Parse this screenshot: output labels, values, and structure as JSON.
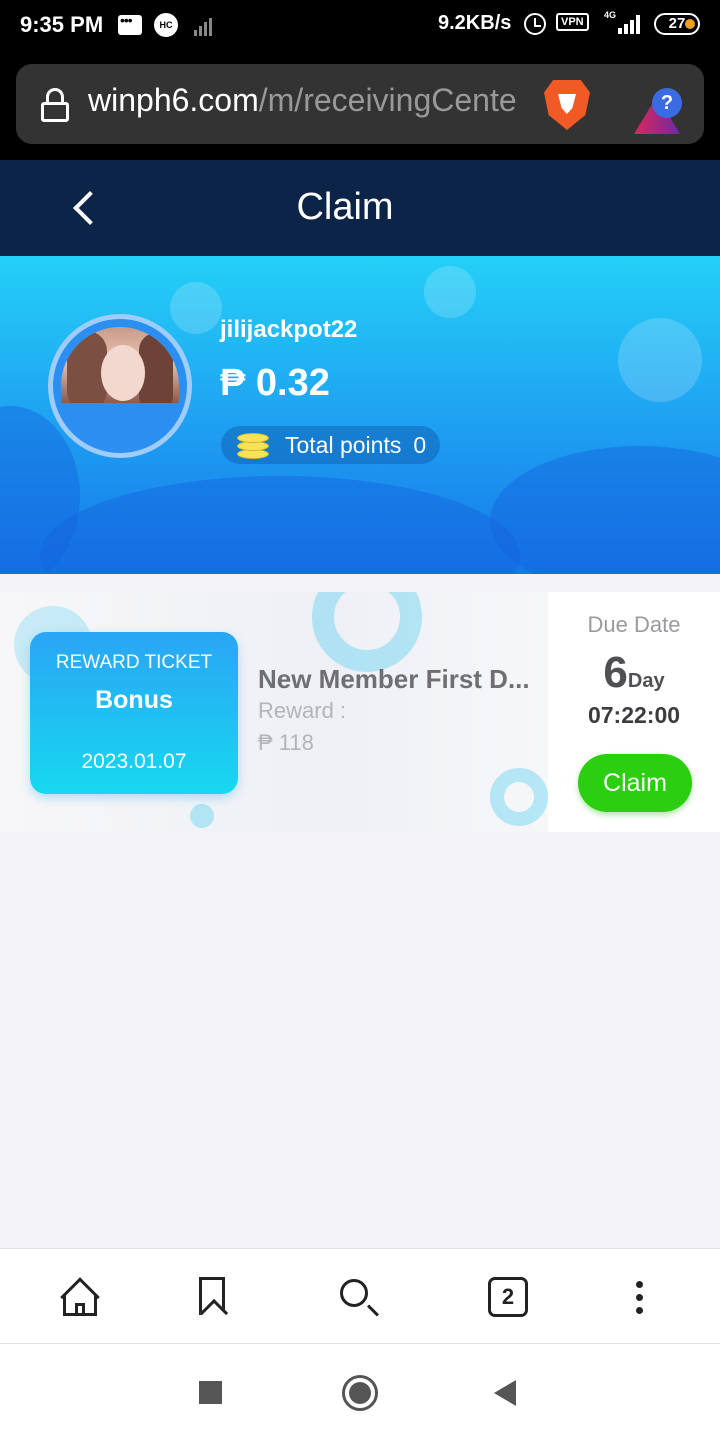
{
  "status_bar": {
    "time": "9:35 PM",
    "hc_badge": "HC",
    "network_speed": "9.2KB/s",
    "vpn_label": "VPN",
    "network_type": "4G",
    "battery": "27"
  },
  "browser": {
    "url_host": "winph6.com",
    "url_path": "/m/receivingCente",
    "tab_count": "2",
    "rewards_badge": "?"
  },
  "header": {
    "title": "Claim"
  },
  "profile": {
    "username": "jilijackpot22",
    "balance": "₱ 0.32",
    "points_label": "Total points",
    "points_value": "0"
  },
  "tickets": [
    {
      "ticket_title": "REWARD TICKET",
      "ticket_name": "Bonus",
      "ticket_date": "2023.01.07",
      "event_title": "New Member First D...",
      "reward_label": "Reward :",
      "reward_amount": "₱ 118",
      "due_label": "Due Date",
      "due_days": "6",
      "due_unit": "Day",
      "due_time": "07:22:00",
      "claim_label": "Claim"
    }
  ],
  "colors": {
    "header_bg": "#0c2447",
    "banner_top": "#24d0f7",
    "banner_bottom": "#1676ea",
    "claim_button": "#2ccf10",
    "ticket_card": "#17d8f0"
  },
  "icons": {
    "browser_shield": "brave-lion-icon",
    "browser_rewards": "rewards-triangle-icon",
    "bottom_nav": [
      "home-icon",
      "bookmark-icon",
      "search-icon",
      "tabs-icon",
      "more-menu-icon"
    ],
    "system_nav": [
      "recents-icon",
      "home-icon",
      "back-icon"
    ]
  }
}
